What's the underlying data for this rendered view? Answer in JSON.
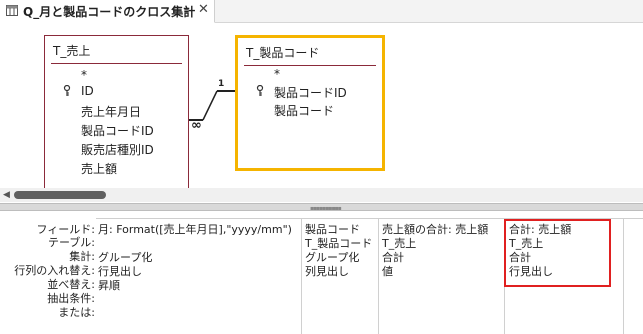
{
  "tab": {
    "title": "Q_月と製品コードのクロス集計",
    "close": "✕"
  },
  "tables": {
    "sales": {
      "name": "T_売上",
      "fields": [
        "*",
        "ID",
        "売上年月日",
        "製品コードID",
        "販売店種別ID",
        "売上額"
      ]
    },
    "product": {
      "name": "T_製品コード",
      "fields": [
        "*",
        "製品コードID",
        "製品コード"
      ]
    }
  },
  "relationship": {
    "one_label": "1",
    "many_label": "∞"
  },
  "grid": {
    "row_labels": [
      "フィールド:",
      "テーブル:",
      "集計:",
      "行列の入れ替え:",
      "並べ替え:",
      "抽出条件:",
      "または:"
    ],
    "columns": [
      {
        "field": "月: Format([売上年月日],\"yyyy/mm\")",
        "table": "",
        "total": "グループ化",
        "crosstab": "行見出し",
        "sort": "昇順"
      },
      {
        "field": "製品コード",
        "table": "T_製品コード",
        "total": "グループ化",
        "crosstab": "列見出し",
        "sort": ""
      },
      {
        "field": "売上額の合計: 売上額",
        "table": "T_売上",
        "total": "合計",
        "crosstab": "値",
        "sort": ""
      },
      {
        "field": "合計: 売上額",
        "table": "T_売上",
        "total": "合計",
        "crosstab": "行見出し",
        "sort": ""
      }
    ]
  },
  "colors": {
    "highlight": "#e02020",
    "selected_table_border": "#f5b400",
    "table_border": "#8b2a3a"
  }
}
